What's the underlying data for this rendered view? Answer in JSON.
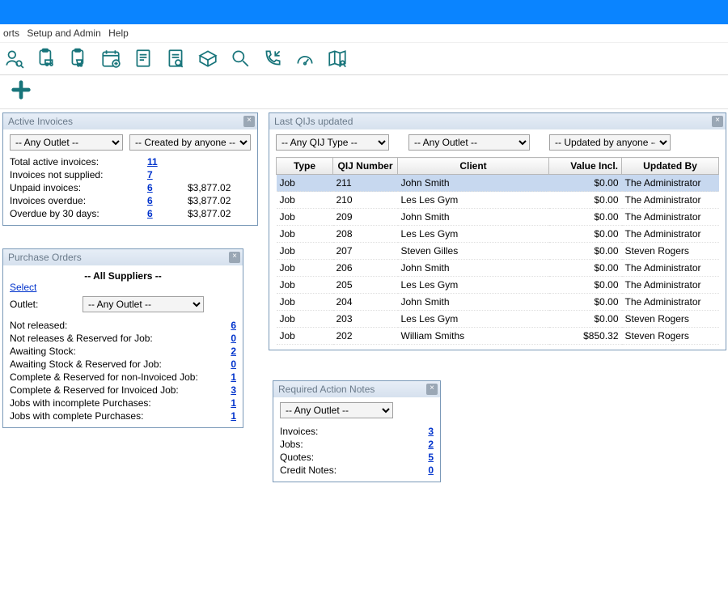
{
  "menu": {
    "reports": "orts",
    "setup": "Setup and Admin",
    "help": "Help"
  },
  "active_invoices": {
    "title": "Active Invoices",
    "dd_outlet": "-- Any Outlet --",
    "dd_creator": "-- Created by anyone --",
    "rows": [
      {
        "label": "Total active invoices:",
        "count": "11",
        "amount": ""
      },
      {
        "label": "Invoices not supplied:",
        "count": "7",
        "amount": ""
      },
      {
        "label": "Unpaid invoices:",
        "count": "6",
        "amount": "$3,877.02"
      },
      {
        "label": "Invoices overdue:",
        "count": "6",
        "amount": "$3,877.02"
      },
      {
        "label": "Overdue by 30 days:",
        "count": "6",
        "amount": "$3,877.02"
      }
    ]
  },
  "purchase_orders": {
    "title": "Purchase Orders",
    "all_suppliers": "-- All Suppliers --",
    "select_label": "Select",
    "outlet_label": "Outlet:",
    "dd_outlet": "-- Any Outlet --",
    "rows": [
      {
        "label": "Not released:",
        "count": "6"
      },
      {
        "label": "Not releases & Reserved for Job:",
        "count": "0"
      },
      {
        "label": "Awaiting Stock:",
        "count": "2"
      },
      {
        "label": "Awaiting Stock & Reserved for Job:",
        "count": "0"
      },
      {
        "label": "Complete & Reserved for non-Invoiced Job:",
        "count": "1"
      },
      {
        "label": "Complete & Reserved for Invoiced Job:",
        "count": "3"
      },
      {
        "label": "Jobs with incomplete Purchases:",
        "count": "1"
      },
      {
        "label": "Jobs with complete Purchases:",
        "count": "1"
      }
    ]
  },
  "last_qij": {
    "title": "Last QIJs updated",
    "dd_type": "-- Any QIJ Type --",
    "dd_outlet": "-- Any Outlet --",
    "dd_updater": "-- Updated by anyone --",
    "headers": {
      "type": "Type",
      "qij": "QIJ Number",
      "client": "Client",
      "value": "Value Incl.",
      "updated": "Updated By"
    },
    "rows": [
      {
        "type": "Job",
        "qij": "211",
        "client": "John Smith",
        "value": "$0.00",
        "updated": "The Administrator",
        "selected": true
      },
      {
        "type": "Job",
        "qij": "210",
        "client": "Les Les Gym",
        "value": "$0.00",
        "updated": "The Administrator"
      },
      {
        "type": "Job",
        "qij": "209",
        "client": "John Smith",
        "value": "$0.00",
        "updated": "The Administrator"
      },
      {
        "type": "Job",
        "qij": "208",
        "client": "Les Les Gym",
        "value": "$0.00",
        "updated": "The Administrator"
      },
      {
        "type": "Job",
        "qij": "207",
        "client": "Steven Gilles",
        "value": "$0.00",
        "updated": "Steven Rogers"
      },
      {
        "type": "Job",
        "qij": "206",
        "client": "John Smith",
        "value": "$0.00",
        "updated": "The Administrator"
      },
      {
        "type": "Job",
        "qij": "205",
        "client": "Les Les Gym",
        "value": "$0.00",
        "updated": "The Administrator"
      },
      {
        "type": "Job",
        "qij": "204",
        "client": "John Smith",
        "value": "$0.00",
        "updated": "The Administrator"
      },
      {
        "type": "Job",
        "qij": "203",
        "client": "Les Les Gym",
        "value": "$0.00",
        "updated": "Steven Rogers"
      },
      {
        "type": "Job",
        "qij": "202",
        "client": "William Smiths",
        "value": "$850.32",
        "updated": "Steven Rogers"
      }
    ]
  },
  "action_notes": {
    "title": "Required Action Notes",
    "dd_outlet": "-- Any Outlet --",
    "rows": [
      {
        "label": "Invoices:",
        "count": "3"
      },
      {
        "label": "Jobs:",
        "count": "2"
      },
      {
        "label": "Quotes:",
        "count": "5"
      },
      {
        "label": "Credit Notes:",
        "count": "0"
      }
    ]
  }
}
